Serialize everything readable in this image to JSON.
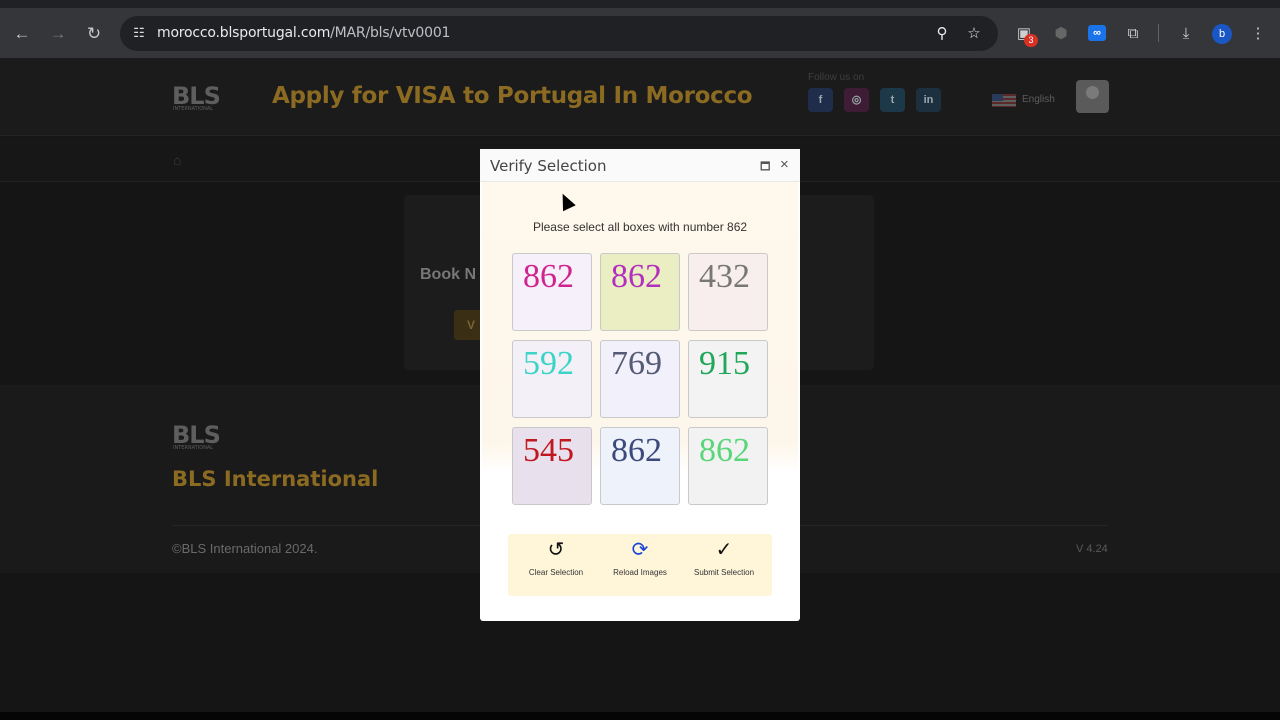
{
  "browser": {
    "url_host": "morocco.blsportugal.com",
    "url_path": "/MAR/bls/vtv0001",
    "back_icon": "arrow-left-icon",
    "forward_icon": "arrow-right-icon",
    "reload_icon": "reload-icon",
    "site_info_icon": "tune-icon",
    "zoom_icon": "zoom-icon",
    "bookmark_icon": "star-icon",
    "extension_badge": "3",
    "profile_letter": "b",
    "menu_icon": "kebab-icon"
  },
  "header": {
    "logo_text": "BLS",
    "logo_sub": "INTERNATIONAL",
    "title": "Apply for VISA to Portugal In Morocco",
    "follow_label": "Follow us on",
    "social": [
      "f",
      "◎",
      "t",
      "in"
    ],
    "language": "English"
  },
  "page": {
    "card_title": "Book N",
    "card_button": "V"
  },
  "footer": {
    "logo_text": "BLS",
    "logo_sub": "INTERNATIONAL",
    "title": "BLS International",
    "copyright": "©BLS International 2024.",
    "version": "V 4.24"
  },
  "modal": {
    "title": "Verify Selection",
    "instruction": "Please select all boxes with number 862",
    "tiles": [
      {
        "value": "862",
        "color": "#d0248f",
        "bg": "#f6f0fa"
      },
      {
        "value": "862",
        "color": "#b22fbf",
        "bg": "#ebeec2"
      },
      {
        "value": "432",
        "color": "#777777",
        "bg": "#f9eeee"
      },
      {
        "value": "592",
        "color": "#3cd4c8",
        "bg": "#f4f0f7"
      },
      {
        "value": "769",
        "color": "#555a75",
        "bg": "#f2f0fb"
      },
      {
        "value": "915",
        "color": "#21a75a",
        "bg": "#f3f3f3"
      },
      {
        "value": "545",
        "color": "#c0181e",
        "bg": "#e9e0ee"
      },
      {
        "value": "862",
        "color": "#3b4a7a",
        "bg": "#eef2fa"
      },
      {
        "value": "862",
        "color": "#59d67a",
        "bg": "#f2f2f2"
      }
    ],
    "clear_label": "Clear Selection",
    "reload_label": "Reload Images",
    "submit_label": "Submit Selection"
  }
}
